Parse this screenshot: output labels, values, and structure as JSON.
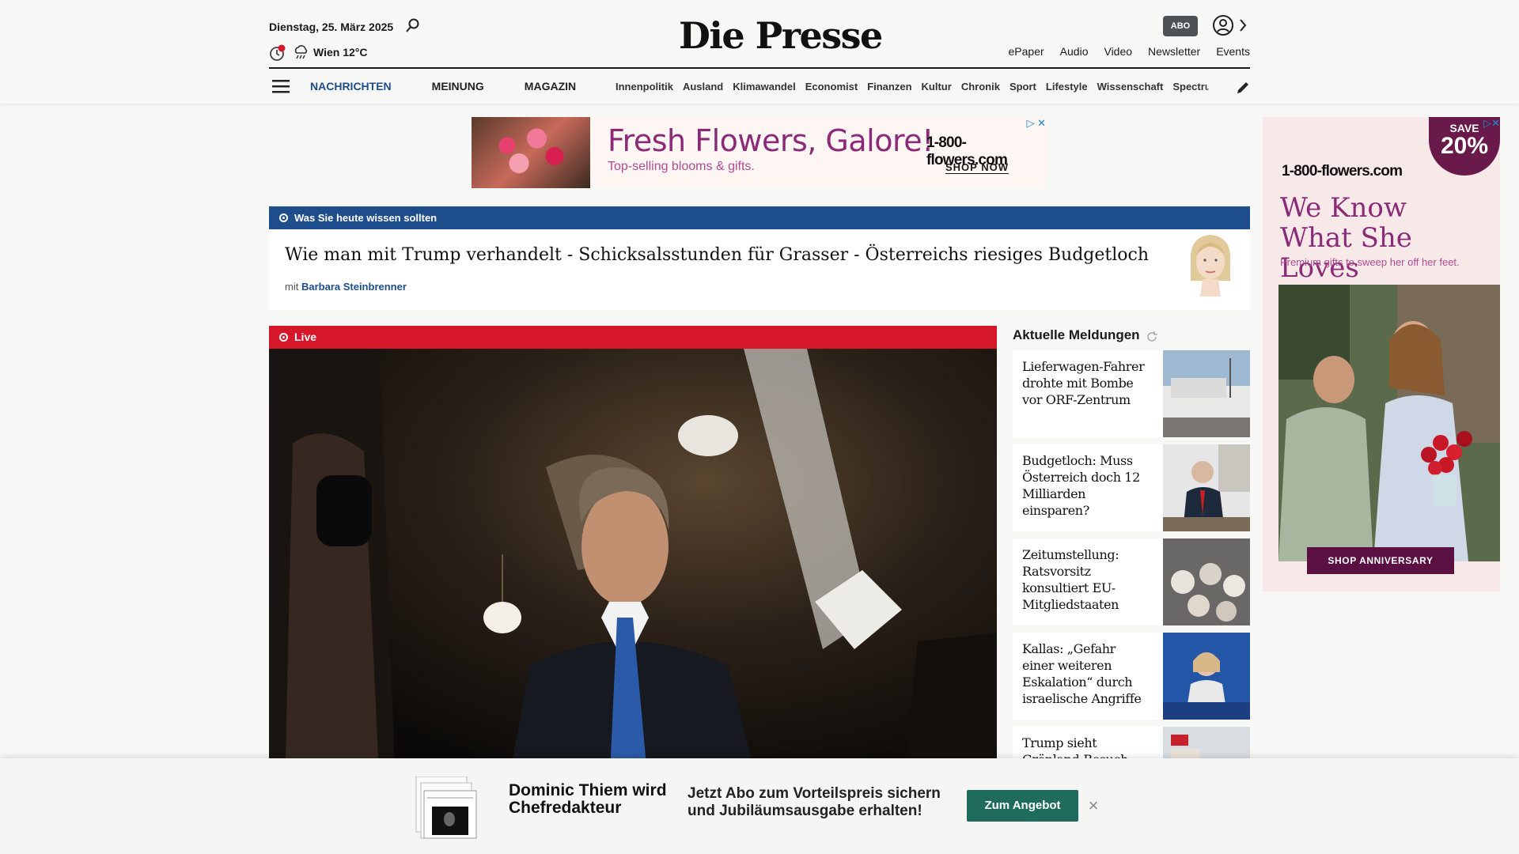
{
  "header": {
    "date": "Dienstag, 25. März 2025",
    "weather": "Wien 12°C",
    "logo": "Die Presse",
    "abo_label": "ABO",
    "top_links": [
      "ePaper",
      "Audio",
      "Video",
      "Newsletter",
      "Events"
    ],
    "main_nav": [
      "NACHRICHTEN",
      "MEINUNG",
      "MAGAZIN"
    ],
    "sub_nav": [
      "Innenpolitik",
      "Ausland",
      "Klimawandel",
      "Economist",
      "Finanzen",
      "Kultur",
      "Chronik",
      "Sport",
      "Lifestyle",
      "Wissenschaft",
      "Spectrum"
    ]
  },
  "top_ad": {
    "headline": "Fresh Flowers, Galore!",
    "subline": "Top-selling blooms & gifts.",
    "brand": "1-800-flowers.com",
    "cta": "SHOP NOW"
  },
  "briefing": {
    "label": "Was Sie heute wissen sollten",
    "title": "Wie man mit Trump verhandelt - Schicksalsstunden für Grasser - Österreichs riesiges Budgetloch",
    "author_prefix": "mit",
    "author": "Barbara Steinbrenner"
  },
  "live": {
    "label": "Live"
  },
  "aktuelle": {
    "title": "Aktuelle Meldungen",
    "items": [
      {
        "text": "Lieferwagen-Fahrer drohte mit Bombe vor ORF-Zentrum"
      },
      {
        "text": "Budgetloch: Muss Österreich doch 12 Milliarden einsparen?"
      },
      {
        "text": "Zeitumstellung: Ratsvorsitz konsultiert EU-Mitgliedstaaten"
      },
      {
        "text": "Kallas: „Gefahr einer weiteren Eskalation“ durch israelische Angriffe"
      },
      {
        "text": "Trump sieht Grönland-Besuch"
      }
    ]
  },
  "side_ad": {
    "badge_save": "SAVE",
    "badge_pct": "20%",
    "brand": "1-800-flowers.com",
    "headline": "We Know What She Loves",
    "subline": "Premium gifts to sweep her off her feet.",
    "cta": "SHOP ANNIVERSARY"
  },
  "promo": {
    "headline": "Dominic Thiem wird Chefredakteur",
    "text": "Jetzt Abo zum Vorteilspreis sichern und Jubiläumsausgabe erhalten!",
    "button": "Zum Angebot",
    "close": "×"
  },
  "colors": {
    "accent_blue": "#1e4d8b",
    "live_red": "#d6172a",
    "promo_green": "#1f6b5c",
    "ad_purple": "#8a2a78"
  }
}
